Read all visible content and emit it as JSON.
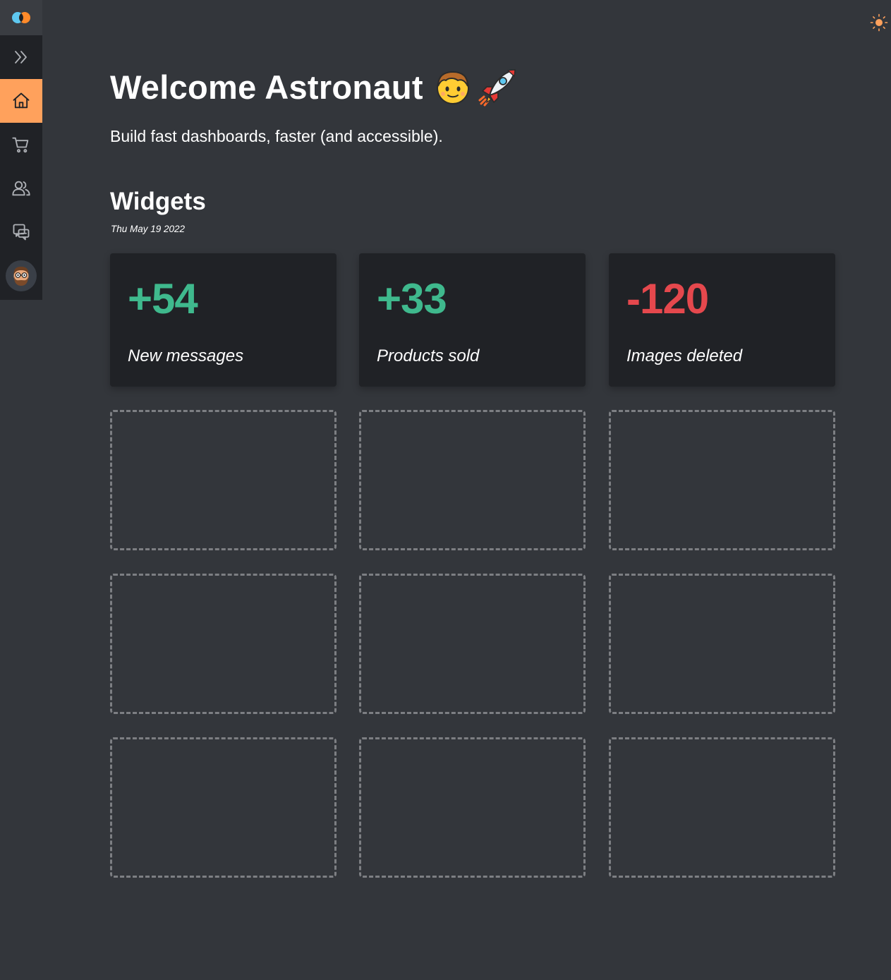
{
  "header": {
    "title": "Welcome Astronaut",
    "subtitle": "Build fast dashboards, faster (and accessible)."
  },
  "widgets": {
    "heading": "Widgets",
    "date": "Thu May 19 2022",
    "cards": [
      {
        "value": "+54",
        "label": "New messages",
        "color": "#3fb98d"
      },
      {
        "value": "+33",
        "label": "Products sold",
        "color": "#3fb98d"
      },
      {
        "value": "-120",
        "label": "Images deleted",
        "color": "#e5484d"
      }
    ],
    "placeholder_count": 9
  },
  "sidebar": {
    "items": [
      {
        "icon": "app-logo-icon"
      },
      {
        "icon": "expand-chevrons-icon"
      },
      {
        "icon": "home-icon",
        "active": true
      },
      {
        "icon": "shopping-cart-icon"
      },
      {
        "icon": "users-icon"
      },
      {
        "icon": "messages-icon"
      },
      {
        "icon": "user-avatar"
      }
    ]
  },
  "colors": {
    "background": "#33363b",
    "sidebar": "#202226",
    "accent": "#ffa15c",
    "positive": "#3fb98d",
    "negative": "#e5484d"
  }
}
